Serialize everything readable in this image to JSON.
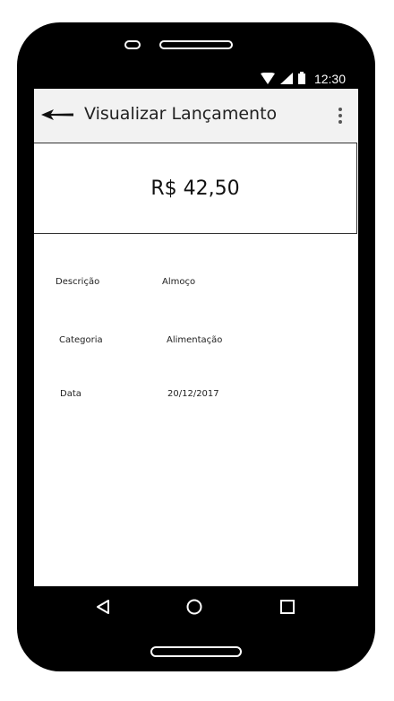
{
  "status_bar": {
    "time": "12:30",
    "icons": [
      "wifi-icon",
      "signal-icon",
      "battery-icon"
    ]
  },
  "app_bar": {
    "title": "Visualizar Lançamento",
    "back_icon": "arrow-left-icon",
    "menu_icon": "overflow-menu-icon"
  },
  "entry": {
    "amount": "R$ 42,50",
    "fields": [
      {
        "label": "Descrição",
        "value": "Almoço"
      },
      {
        "label": "Categoria",
        "value": "Alimentação"
      },
      {
        "label": "Data",
        "value": "20/12/2017"
      }
    ]
  },
  "nav_bar": {
    "icons": [
      "back-triangle-icon",
      "home-circle-icon",
      "recents-square-icon"
    ]
  }
}
